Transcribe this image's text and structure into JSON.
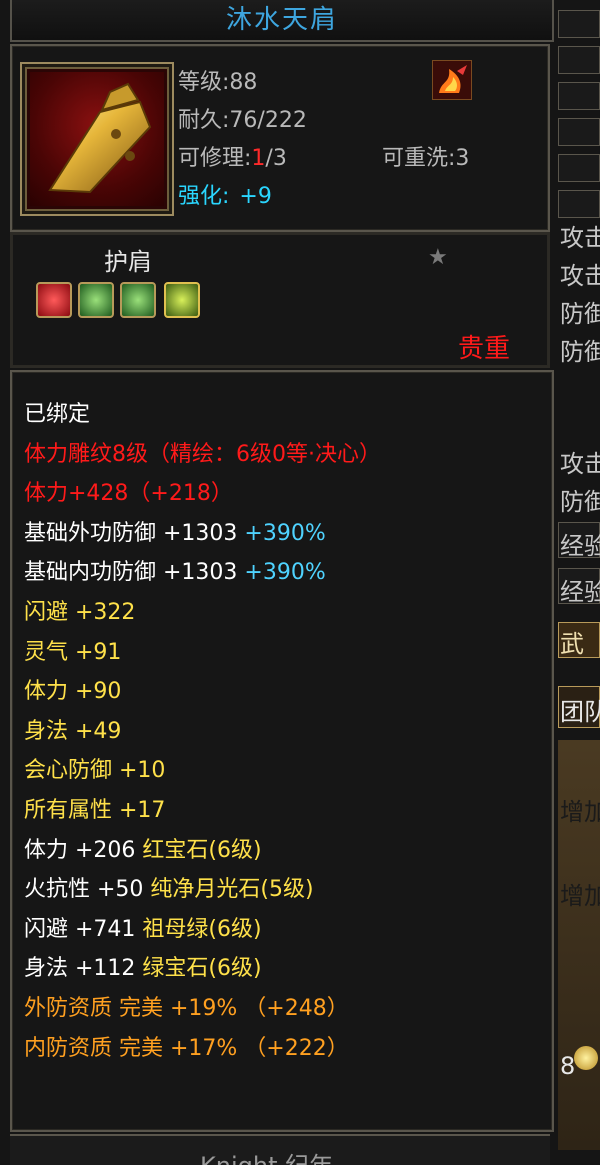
{
  "item": {
    "name": "沐水天肩",
    "level_text": "等级:88",
    "durability_text": "耐久:76/222",
    "repair_prefix": "可修理:",
    "repair_used": "1",
    "repair_total": "/3",
    "rewash_text": "可重洗:3",
    "enhance_label": "强化:",
    "enhance_value": "+9",
    "slot": "护肩",
    "rarity": "贵重",
    "footer": "Knight 纪年"
  },
  "attributes": [
    {
      "text": "已绑定",
      "color": "#ffffff"
    },
    {
      "text": "体力雕纹8级（精绘：6级0等·决心）",
      "color": "#ff1a1a"
    },
    {
      "text": "体力+428（+218）",
      "color": "#ff1a1a"
    },
    {
      "text": "基础外功防御 +1303",
      "extra": " +390%",
      "color": "#ffffff",
      "extra_color": "#4fd3ff"
    },
    {
      "text": "基础内功防御 +1303",
      "extra": " +390%",
      "color": "#ffffff",
      "extra_color": "#4fd3ff"
    },
    {
      "text": "闪避 +322",
      "color": "#ffe14a"
    },
    {
      "text": "灵气 +91",
      "color": "#ffe14a"
    },
    {
      "text": "体力 +90",
      "color": "#ffe14a"
    },
    {
      "text": "身法 +49",
      "color": "#ffe14a"
    },
    {
      "text": "会心防御 +10",
      "color": "#ffe14a"
    },
    {
      "text": "所有属性 +17",
      "color": "#ffe14a"
    },
    {
      "text": "体力 +206",
      "extra": " 红宝石(6级)",
      "color": "#ffffff",
      "extra_color": "#ffe14a"
    },
    {
      "text": "火抗性 +50",
      "extra": " 纯净月光石(5级)",
      "color": "#ffffff",
      "extra_color": "#ffe14a"
    },
    {
      "text": "闪避 +741",
      "extra": " 祖母绿(6级)",
      "color": "#ffffff",
      "extra_color": "#ffe14a"
    },
    {
      "text": "身法 +112",
      "extra": " 绿宝石(6级)",
      "color": "#ffffff",
      "extra_color": "#ffe14a"
    },
    {
      "text": "外防资质  完美 +19% （+248）",
      "color": "#ffa020"
    },
    {
      "text": "内防资质  完美 +17% （+222）",
      "color": "#ffa020"
    }
  ],
  "gems": [
    {
      "name": "red-gem-icon",
      "color": "#d0202a"
    },
    {
      "name": "green-gem-icon",
      "color": "#2d9a3a"
    },
    {
      "name": "green-gem-icon",
      "color": "#2d9a3a"
    },
    {
      "name": "yellowgreen-gem-icon",
      "color": "#8fbf2a"
    }
  ],
  "side_panel": {
    "labels": [
      "攻击",
      "攻击",
      "防御",
      "防御",
      "攻击",
      "防御",
      "经验",
      "经验",
      "武",
      "团队",
      "增加",
      "增加",
      "8"
    ]
  },
  "colors": {
    "title": "#3ea6df",
    "enhance": "#2ad6ff",
    "rarity": "#ff1a1a",
    "border": "#5a564c"
  }
}
